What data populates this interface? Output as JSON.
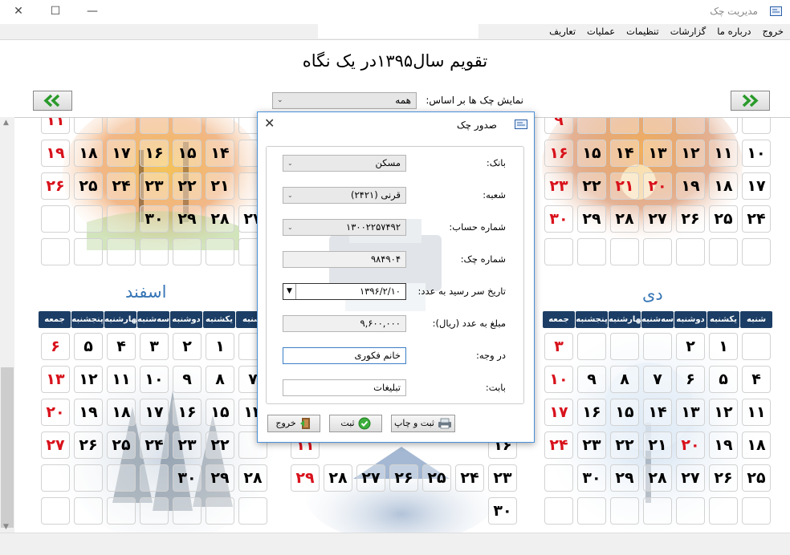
{
  "window": {
    "title": "مدیریت چک",
    "minimize_glyph": "—",
    "maximize_glyph": "☐",
    "close_glyph": "✕"
  },
  "menu": {
    "items": [
      "تعاریف",
      "عملیات",
      "تنظیمات",
      "گزارشات",
      "درباره ما",
      "خروج"
    ]
  },
  "page_title": "تقویم سال۱۳۹۵در یک نگاه",
  "filter": {
    "label": "نمایش چک ها بر اساس:",
    "value": "همه"
  },
  "calendars": {
    "weekdays": [
      "شنبه",
      "یکشنبه",
      "دوشنبه",
      "سه‌شنبه",
      "چهارشنبه",
      "پنجشنبه",
      "جمعه"
    ],
    "top_right_rows": [
      [
        "",
        "",
        "",
        "",
        "",
        "",
        "۹"
      ],
      [
        "۱۰",
        "۱۱",
        "۱۲",
        "۱۳",
        "۱۴",
        "۱۵",
        "۱۶"
      ],
      [
        "۱۷",
        "۱۸",
        "۱۹",
        "۲۰",
        "۲۱",
        "۲۲",
        "۲۳"
      ],
      [
        "۲۴",
        "۲۵",
        "۲۶",
        "۲۷",
        "۲۸",
        "۲۹",
        "۳۰"
      ],
      [
        "",
        "",
        "",
        "",
        "",
        "",
        ""
      ]
    ],
    "top_left_rows": [
      [
        "",
        "",
        "",
        "",
        "",
        "",
        "۱۱"
      ],
      [
        "",
        "۱۴",
        "۱۵",
        "۱۶",
        "۱۷",
        "۱۸",
        "۱۹"
      ],
      [
        "",
        "۲۱",
        "۲۲",
        "۲۳",
        "۲۴",
        "۲۵",
        "۲۶"
      ],
      [
        "۲۷",
        "۲۸",
        "۲۹",
        "۳۰",
        "",
        "",
        ""
      ],
      [
        "",
        "",
        "",
        "",
        "",
        "",
        ""
      ]
    ],
    "dey": {
      "name": "دی",
      "rows": [
        [
          "",
          "۱",
          "۲",
          "",
          "",
          "",
          "۳"
        ],
        [
          "۴",
          "۵",
          "۶",
          "۷",
          "۸",
          "۹",
          "۱۰"
        ],
        [
          "۱۱",
          "۱۲",
          "۱۳",
          "۱۴",
          "۱۵",
          "۱۶",
          "۱۷"
        ],
        [
          "۱۸",
          "۱۹",
          "۲۰",
          "۲۱",
          "۲۲",
          "۲۳",
          "۲۴"
        ],
        [
          "۲۵",
          "۲۶",
          "۲۷",
          "۲۸",
          "۲۹",
          "۳۰",
          ""
        ],
        [
          "",
          "",
          "",
          "",
          "",
          "",
          ""
        ]
      ]
    },
    "esfand": {
      "name": "اسفند",
      "rows": [
        [
          "",
          "۱",
          "۲",
          "۳",
          "۴",
          "۵",
          "۶"
        ],
        [
          "۷",
          "۸",
          "۹",
          "۱۰",
          "۱۱",
          "۱۲",
          "۱۳"
        ],
        [
          "۱۴",
          "۱۵",
          "۱۶",
          "۱۷",
          "۱۸",
          "۱۹",
          "۲۰"
        ],
        [
          "",
          "۲۲",
          "۲۳",
          "۲۴",
          "۲۵",
          "۲۶",
          "۲۷"
        ],
        [
          "۲۸",
          "۲۹",
          "۳۰",
          "",
          "",
          "",
          ""
        ],
        [
          "",
          "",
          "",
          "",
          "",
          "",
          ""
        ]
      ]
    },
    "bahman_visible": [
      [
        "۱۶",
        "",
        "",
        "",
        "",
        "",
        "۱۱"
      ],
      [
        "۲۳",
        "۲۴",
        "۲۵",
        "۲۶",
        "۲۷",
        "۲۸",
        "۲۹"
      ],
      [
        "۳۰",
        "",
        "",
        "",
        "",
        "",
        ""
      ]
    ],
    "red_highlight": [
      "۲۲",
      "۲۰",
      "۲۱"
    ]
  },
  "dialog": {
    "title": "صدور چک",
    "close_glyph": "✕",
    "fields": [
      {
        "label": "بانک:",
        "value": "مسکن",
        "kind": "combo"
      },
      {
        "label": "شعبه:",
        "value": "قرنی (۲۴۲۱)",
        "kind": "combo"
      },
      {
        "label": "شماره حساب:",
        "value": "۱۳۰۰۲۲۵۷۴۹۲",
        "kind": "combo"
      },
      {
        "label": "شماره چک:",
        "value": "۹۸۴۹۰۴",
        "kind": "ro"
      },
      {
        "label": "تاریخ سر رسید به عدد:",
        "value": "۱۳۹۶/۲/۱۰",
        "kind": "date"
      },
      {
        "label": "مبلغ به عدد (ریال):",
        "value": "۹,۶۰۰,۰۰۰",
        "kind": "ro"
      },
      {
        "label": "در وجه:",
        "value": "خانم فکوری",
        "kind": "focus"
      },
      {
        "label": "بابت:",
        "value": "تبلیغات",
        "kind": "text"
      }
    ],
    "buttons": {
      "print": "ثبت و چاپ",
      "save": "ثبت",
      "exit": "خروج"
    }
  },
  "colors": {
    "header_bg": "#1c3e66",
    "month_name": "#3776b6",
    "weekend_red": "#d8121c",
    "nav_arrow": "#2a9a2a"
  }
}
